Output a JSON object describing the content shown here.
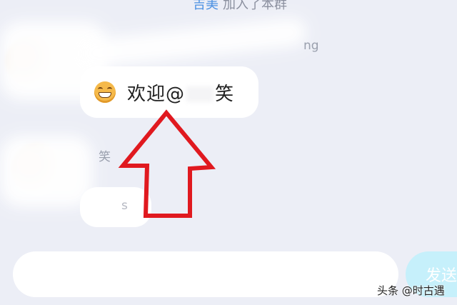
{
  "chat": {
    "system_name": "吉美",
    "system_text": "加入了本群",
    "first_sender_meta": "ng",
    "welcome_prefix": "欢迎@",
    "welcome_suffix": "笑",
    "second_sender_name": "笑",
    "second_message_tail": "s"
  },
  "composer": {
    "input_value": "",
    "send_label": "发送"
  },
  "watermark": "头条 @时古遇",
  "colors": {
    "background": "#eceef6",
    "annotation_arrow": "#e0191f",
    "send_button": "#c6f0fb",
    "system_name": "#4a90e2"
  },
  "icons": {
    "emoji": "grinning-face-icon"
  }
}
